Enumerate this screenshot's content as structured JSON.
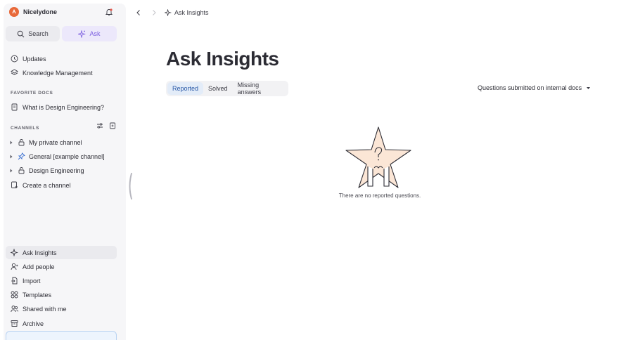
{
  "workspace": {
    "name": "Nicelydone",
    "accent": "#e8693a"
  },
  "toolbar": {
    "search_label": "Search",
    "ask_label": "Ask"
  },
  "nav": {
    "updates": "Updates",
    "knowledge": "Knowledge Management"
  },
  "favorites": {
    "label": "FAVORITE DOCS",
    "items": [
      "What is Design Engineering?"
    ]
  },
  "channels": {
    "label": "CHANNELS",
    "items": [
      "My private channel",
      "General [example channel]",
      "Design Engineering"
    ],
    "create_label": "Create a channel"
  },
  "bottom_nav": {
    "ask_insights": "Ask Insights",
    "add_people": "Add people",
    "import": "Import",
    "templates": "Templates",
    "shared": "Shared with me",
    "archive": "Archive"
  },
  "breadcrumb": {
    "current": "Ask Insights"
  },
  "main": {
    "title": "Ask Insights",
    "tabs": [
      "Reported",
      "Solved",
      "Missing answers"
    ],
    "active_tab": "Reported",
    "filter_label": "Questions submitted on internal docs",
    "empty_text": "There are no reported questions."
  }
}
